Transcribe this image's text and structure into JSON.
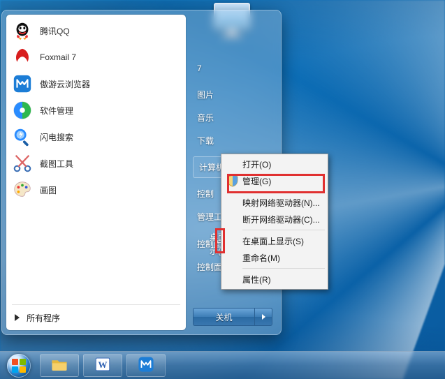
{
  "monitor_icon": "computer-icon",
  "start_menu": {
    "programs": [
      {
        "id": "tencent-qq",
        "label": "腾讯QQ",
        "icon": "qq-icon"
      },
      {
        "id": "foxmail",
        "label": "Foxmail 7",
        "icon": "foxmail-icon"
      },
      {
        "id": "maxthon",
        "label": "傲游云浏览器",
        "icon": "maxthon-icon"
      },
      {
        "id": "software-manager",
        "label": "软件管理",
        "icon": "software-manager-icon"
      },
      {
        "id": "lightning-search",
        "label": "闪电搜索",
        "icon": "lightning-search-icon"
      },
      {
        "id": "screenshot-tool",
        "label": "截图工具",
        "icon": "scissor-icon"
      },
      {
        "id": "paint",
        "label": "画图",
        "icon": "paint-icon"
      }
    ],
    "all_programs_label": "所有程序",
    "right_links": {
      "seven": "7",
      "pictures": "图片",
      "music": "音乐",
      "downloads": "下载",
      "computer": "计算机",
      "control": "控制",
      "management": "管理工",
      "control_desktop": "控制面",
      "control_show": "控制面",
      "behind_desktop": "桌面",
      "behind_show": "示(S)"
    },
    "shutdown_label": "关机"
  },
  "context_menu": {
    "items": [
      {
        "id": "open",
        "label": "打开(O)"
      },
      {
        "id": "manage",
        "label": "管理(G)",
        "icon": "shield-icon",
        "highlighted": true
      },
      {
        "sep": true
      },
      {
        "id": "map-drive",
        "label": "映射网络驱动器(N)..."
      },
      {
        "id": "disconnect-drive",
        "label": "断开网络驱动器(C)..."
      },
      {
        "sep": true
      },
      {
        "id": "show-on-desktop",
        "label": "在桌面上显示(S)"
      },
      {
        "id": "rename",
        "label": "重命名(M)"
      },
      {
        "sep": true
      },
      {
        "id": "properties",
        "label": "属性(R)"
      }
    ]
  },
  "taskbar": {
    "buttons": [
      {
        "id": "explorer",
        "icon": "folder-icon"
      },
      {
        "id": "word",
        "icon": "word-icon"
      },
      {
        "id": "maxthon-tb",
        "icon": "maxthon-icon"
      }
    ]
  }
}
